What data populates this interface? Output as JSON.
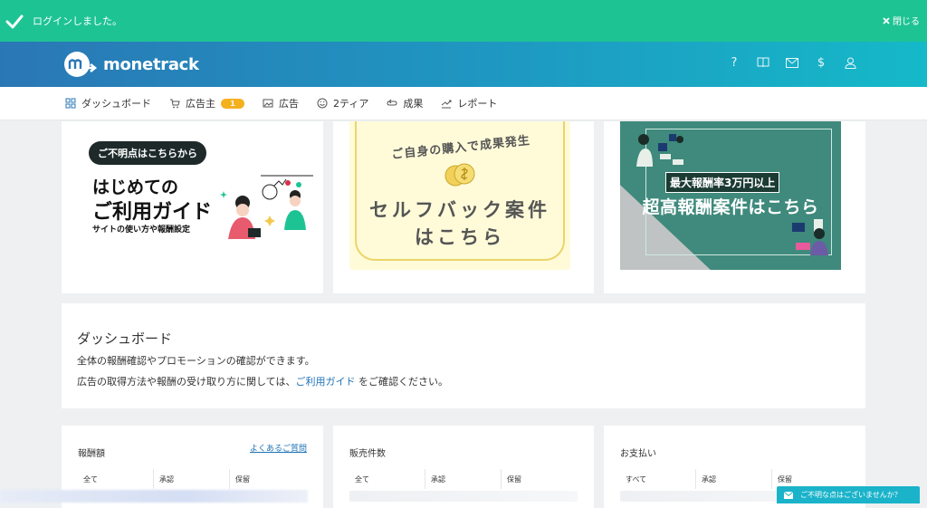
{
  "toast": {
    "message": "ログインしました。",
    "close_label": "閉じる"
  },
  "header": {
    "logo_text": "monetrack",
    "icons": [
      "help-icon",
      "book-icon",
      "mail-icon",
      "dollar-icon",
      "user-icon"
    ],
    "icon_glyphs": {
      "help": "?",
      "dollar": "$"
    }
  },
  "nav": {
    "items": [
      {
        "label": "ダッシュボード",
        "icon": "grid-icon"
      },
      {
        "label": "広告主",
        "icon": "cart-icon",
        "badge": "1"
      },
      {
        "label": "広告",
        "icon": "image-icon"
      },
      {
        "label": "2ティア",
        "icon": "smile-icon"
      },
      {
        "label": "成果",
        "icon": "loop-icon"
      },
      {
        "label": "レポート",
        "icon": "chart-icon"
      }
    ]
  },
  "banners": {
    "guide": {
      "pill": "ご不明点はこちらから",
      "title1": "はじめての",
      "title2": "ご利用ガイド",
      "subtitle": "サイトの使い方や報酬設定"
    },
    "selfback": {
      "arc_text": "ご自身の購入で成果発生",
      "line1": "セルフバック案件",
      "line2": "はこちら"
    },
    "highpay": {
      "sub": "最大報酬率3万円以上",
      "main": "超高報酬案件はこちら"
    }
  },
  "dashboard": {
    "title": "ダッシュボード",
    "line1": "全体の報酬確認やプロモーションの確認ができます。",
    "line2_before": "広告の取得方法や報酬の受け取り方に関しては、",
    "line2_link": "ご利用ガイド",
    "line2_after": " をご確認ください。"
  },
  "stats": [
    {
      "title": "報酬額",
      "faq": "よくあるご質問",
      "columns": [
        "全て",
        "承認",
        "保留"
      ]
    },
    {
      "title": "販売件数",
      "columns": [
        "全て",
        "承認",
        "保留"
      ]
    },
    {
      "title": "お支払い",
      "columns": [
        "すべて",
        "承認",
        "保留"
      ]
    }
  ],
  "help_button": {
    "label": "ご不明な点はございませんか？"
  },
  "colors": {
    "toast": "#1ec394",
    "header_start": "#2a77b5",
    "header_end": "#15b9c8",
    "badge": "#f5b01e",
    "link": "#1f73b7",
    "help": "#1ab3ca"
  }
}
